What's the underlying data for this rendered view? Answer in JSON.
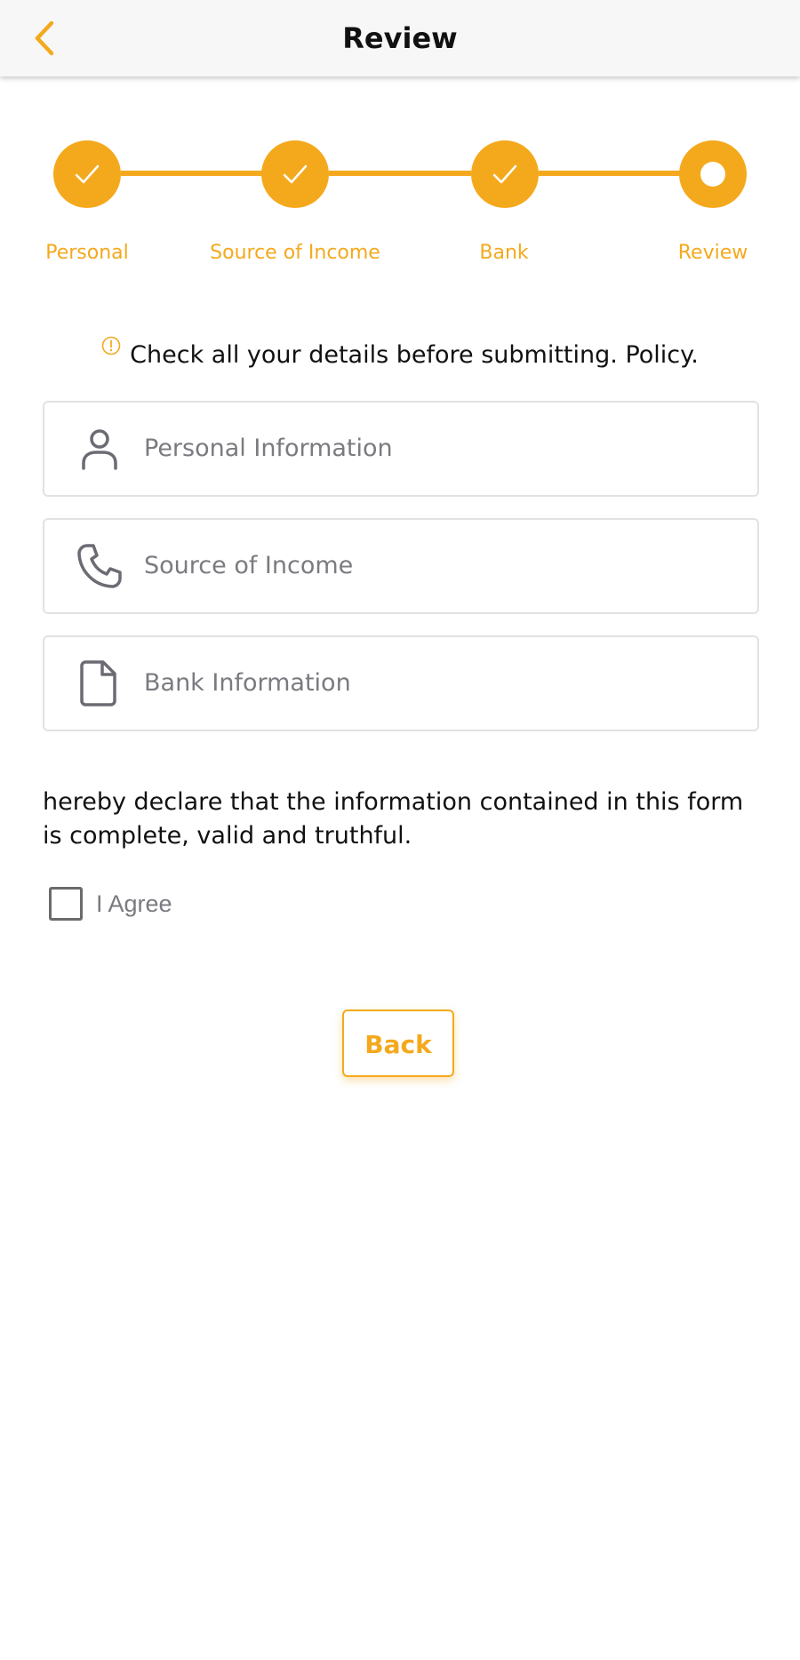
{
  "header": {
    "title": "Review",
    "back_icon": "chevron-left-icon"
  },
  "stepper": {
    "steps": [
      {
        "label": "Personal",
        "state": "completed"
      },
      {
        "label": "Source of Income",
        "state": "completed"
      },
      {
        "label": "Bank",
        "state": "completed"
      },
      {
        "label": "Review",
        "state": "current"
      }
    ]
  },
  "notice": {
    "icon": "info-circle-icon",
    "text": "Check all your details before submitting. Policy."
  },
  "sections": [
    {
      "label": "Personal Information",
      "icon": "user-icon"
    },
    {
      "label": "Source of Income",
      "icon": "phone-icon"
    },
    {
      "label": "Bank Information",
      "icon": "document-icon"
    }
  ],
  "declaration": {
    "text": "hereby declare that the information contained in this form is complete, valid and truthful.",
    "agree_label": "I Agree",
    "agree_checked": false
  },
  "actions": {
    "back_label": "Back"
  },
  "colors": {
    "accent": "#f4a91d",
    "text": "#111111",
    "muted": "#7a7a80",
    "border": "#e2e2e2"
  }
}
